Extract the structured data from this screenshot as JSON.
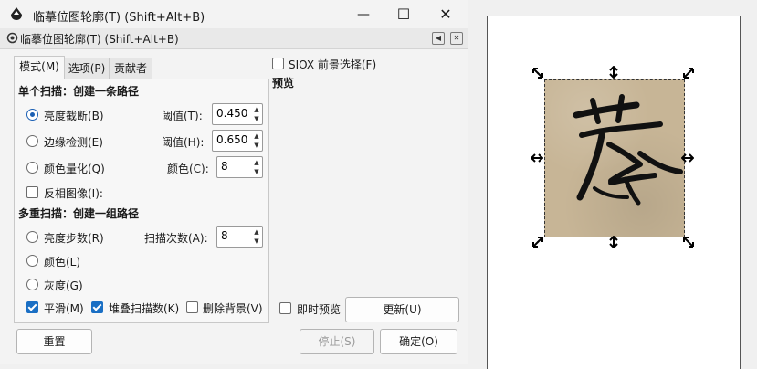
{
  "window": {
    "title": "临摹位图轮廓(T) (Shift+Alt+B)",
    "minimize": "—",
    "maximize": "☐",
    "close": "✕"
  },
  "dock": {
    "title": "临摹位图轮廓(T) (Shift+Alt+B)"
  },
  "tabs": [
    {
      "label": "模式(M)"
    },
    {
      "label": "选项(P)"
    },
    {
      "label": "贡献者"
    }
  ],
  "single_scan": {
    "heading": "单个扫描：创建一条路径",
    "brightness_cutoff": {
      "label": "亮度截断(B)",
      "selected": true,
      "threshold_label": "阈值(T):",
      "threshold_value": "0.450"
    },
    "edge_detection": {
      "label": "边缘检测(E)",
      "selected": false,
      "threshold_label": "阈值(H):",
      "threshold_value": "0.650"
    },
    "color_quant": {
      "label": "颜色量化(Q)",
      "selected": false,
      "colors_label": "颜色(C):",
      "colors_value": "8"
    },
    "invert": {
      "label": "反相图像(I):",
      "checked": false
    }
  },
  "multi_scan": {
    "heading": "多重扫描：创建一组路径",
    "brightness_steps": {
      "label": "亮度步数(R)",
      "selected": false,
      "scans_label": "扫描次数(A):",
      "scans_value": "8"
    },
    "colors": {
      "label": "颜色(L)",
      "selected": false
    },
    "grays": {
      "label": "灰度(G)",
      "selected": false
    },
    "smooth": {
      "label": "平滑(M)",
      "checked": true
    },
    "stack": {
      "label": "堆叠扫描数(K)",
      "checked": true
    },
    "remove_bg": {
      "label": "删除背景(V)",
      "checked": false
    }
  },
  "siox": {
    "label": "SIOX 前景选择(F)",
    "checked": false
  },
  "preview": {
    "heading": "预览",
    "live_label": "即时预览",
    "live_checked": false,
    "update_button": "更新(U)"
  },
  "footer": {
    "reset": "重置",
    "stop": "停止(S)",
    "ok": "确定(O)"
  },
  "colors": {
    "accent": "#1a6fc4",
    "paper": "#c7b596",
    "ink": "#111111"
  }
}
